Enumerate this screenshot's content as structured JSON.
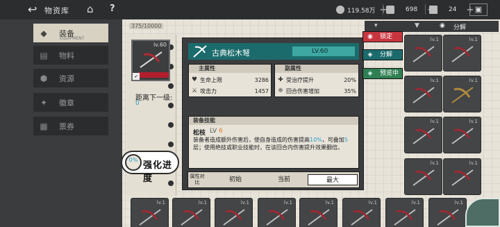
{
  "topbar": {
    "back_icon": "back-arrow-icon",
    "title": "物资库",
    "resources": [
      {
        "icon": "currency-icon",
        "value": "119.58万"
      },
      {
        "icon": "gem-icon",
        "value": "698"
      },
      {
        "icon": "ticket-icon",
        "value": "24"
      }
    ]
  },
  "sidebar": {
    "items": [
      {
        "label": "装备",
        "sub": "EQUIPMENT",
        "icon": "equipment-icon",
        "active": true
      },
      {
        "label": "物料",
        "sub": "",
        "icon": "material-icon",
        "active": false
      },
      {
        "label": "资源",
        "sub": "",
        "icon": "resource-icon",
        "active": false
      },
      {
        "label": "徽章",
        "sub": "",
        "icon": "badge-icon",
        "active": false
      },
      {
        "label": "票券",
        "sub": "",
        "icon": "ticket-icon",
        "active": false
      }
    ]
  },
  "inventory": {
    "capacity": "375/10000",
    "filter_label": "分解",
    "slot_level": "lv.1"
  },
  "detail": {
    "portrait_level": "lv.60",
    "distance_label": "距离下一级:",
    "distance_value": "0",
    "enhance_percent": "0%",
    "enhance_label": "强化进度",
    "weapon_name": "古典松木弩",
    "weapon_level": "LV.60",
    "main_attr": {
      "title": "主属性",
      "rows": [
        {
          "icon": "heart-icon",
          "name": "生命上限",
          "value": "3286"
        },
        {
          "icon": "attack-icon",
          "name": "攻击力",
          "value": "1457"
        }
      ]
    },
    "sub_attr": {
      "title": "副属性",
      "rows": [
        {
          "icon": "heal-icon",
          "name": "受治疗提升",
          "value": "20%"
        },
        {
          "icon": "turn-damage-icon",
          "name": "回合伤害增加",
          "value": "35%"
        }
      ]
    },
    "skill": {
      "title": "装备技能",
      "name": "松枝",
      "level_prefix": "LV",
      "level": "6",
      "desc_1": "装备者造成额外伤害后，使自身造成的伤害提高",
      "desc_hl_1": "10%",
      "desc_2": "，可叠加",
      "desc_hl_2": "5",
      "desc_3": "层；使用绝技或职业技能时，在该回合内伤害提升效果翻倍。"
    },
    "compare": {
      "label": "属性对比",
      "options": [
        "初始",
        "当前",
        "最大"
      ],
      "active": "最大"
    }
  },
  "actions": {
    "lock": "锁定",
    "split": "分解",
    "preview": "预览中"
  },
  "colors": {
    "accent_teal": "#1c6b6c",
    "lock_red": "#c8353f",
    "preview_green": "#2f7f52",
    "highlight_blue": "#2b9bc4"
  }
}
